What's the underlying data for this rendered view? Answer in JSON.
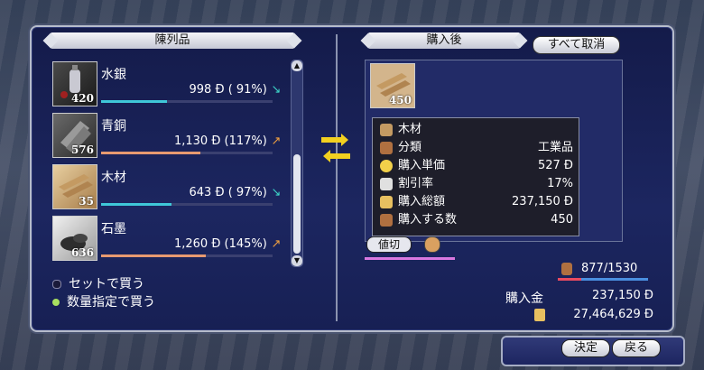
{
  "left_panel": {
    "title": "陳列品",
    "items": [
      {
        "name": "水銀",
        "qty": "420",
        "price": "998",
        "pct": "( 91%)",
        "arrow": "↘",
        "arrow_color": "#3dd6c8",
        "bar_level": 0.91,
        "bar_color": "#3fc7d8"
      },
      {
        "name": "青銅",
        "qty": "576",
        "price": "1,130",
        "pct": "(117%)",
        "arrow": "↗",
        "arrow_color": "#f0a040",
        "bar_level": 1.17,
        "bar_color": "#e89a70"
      },
      {
        "name": "木材",
        "qty": "35",
        "price": "643",
        "pct": "( 97%)",
        "arrow": "↘",
        "arrow_color": "#3dd6c8",
        "bar_level": 0.97,
        "bar_color": "#3fc7d8"
      },
      {
        "name": "石墨",
        "qty": "636",
        "price": "1,260",
        "pct": "(145%)",
        "arrow": "↗",
        "arrow_color": "#f0a040",
        "bar_level": 1.45,
        "bar_color": "#e89a70"
      }
    ],
    "currency_symbol": "Đ"
  },
  "options": {
    "set_buy": "セットで買う",
    "qty_buy": "数量指定で買う"
  },
  "right_panel": {
    "title": "購入後",
    "cancel_all": "すべて取消",
    "selected_qty": "450",
    "tooltip": {
      "name": "木材",
      "rows": [
        {
          "label": "分類",
          "value": "工業品",
          "icon_color": "#b07040"
        },
        {
          "label": "購入単価",
          "value": "527 Đ",
          "icon_color": "#f2d04a"
        },
        {
          "label": "割引率",
          "value": "17%",
          "icon_color": "#e0e0e0"
        },
        {
          "label": "購入総額",
          "value": "237,150 Đ",
          "icon_color": "#e8c060"
        },
        {
          "label": "購入する数",
          "value": "450",
          "icon_color": "#b07040"
        }
      ]
    },
    "negotiate": "値切",
    "capacity": "877/1530",
    "capacity_level": 0.573,
    "purchase_label": "購入金",
    "purchase_value": "237,150 Đ",
    "funds_value": "27,464,629 Đ"
  },
  "buttons": {
    "ok": "決定",
    "back": "戻る"
  },
  "colors": {
    "window_bg": "#1c2660",
    "capacity_bar": "#4a8fe0",
    "capacity_used": "#e84a60",
    "negotiate_bar": "#d978e0"
  }
}
